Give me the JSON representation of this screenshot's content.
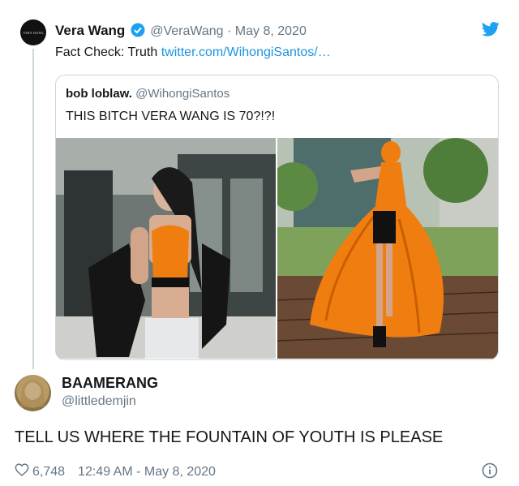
{
  "tweet": {
    "author_name": "Vera Wang",
    "handle": "@VeraWang",
    "separator": "·",
    "date": "May 8, 2020",
    "text_prefix": "Fact Check: Truth ",
    "link": "twitter.com/WihongiSantos/…",
    "avatar_text": "VERA WANG"
  },
  "quoted": {
    "author_name": "bob loblaw.",
    "handle": "@WihongiSantos",
    "text": "THIS BITCH VERA WANG IS 70?!?!"
  },
  "reply": {
    "author_name": "BAAMERANG",
    "handle": "@littledemjin",
    "text": "TELL US WHERE THE FOUNTAIN OF YOUTH IS PLEASE",
    "likes": "6,748",
    "timestamp": "12:49 AM - May 8, 2020"
  },
  "colors": {
    "accent": "#1b95e0",
    "verified": "#1da1f2",
    "orange": "#f07d10"
  },
  "icons": [
    "twitter-bird-icon",
    "verified-badge-icon",
    "heart-icon",
    "info-icon"
  ]
}
